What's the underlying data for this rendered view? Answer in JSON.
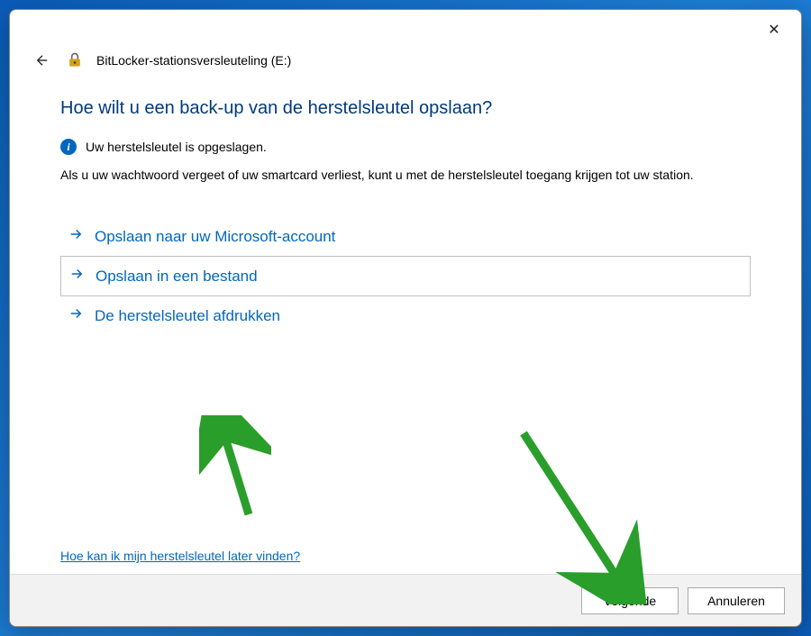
{
  "header": {
    "title": "BitLocker-stationsversleuteling (E:)"
  },
  "main": {
    "heading": "Hoe wilt u een back-up van de herstelsleutel opslaan?",
    "info_text": "Uw herstelsleutel is opgeslagen.",
    "body_text": "Als u uw wachtwoord vergeet of uw smartcard verliest, kunt u met de herstelsleutel toegang krijgen tot uw station.",
    "options": [
      {
        "label": "Opslaan naar uw Microsoft-account",
        "selected": false
      },
      {
        "label": "Opslaan in een bestand",
        "selected": true
      },
      {
        "label": "De herstelsleutel afdrukken",
        "selected": false
      }
    ],
    "help_link": "Hoe kan ik mijn herstelsleutel later vinden?"
  },
  "footer": {
    "next_label": "Volgende",
    "cancel_label": "Annuleren"
  },
  "icons": {
    "close": "✕",
    "info": "i"
  },
  "colors": {
    "accent": "#0067c0",
    "heading": "#003a7a",
    "annotation": "#2a9e2a"
  }
}
